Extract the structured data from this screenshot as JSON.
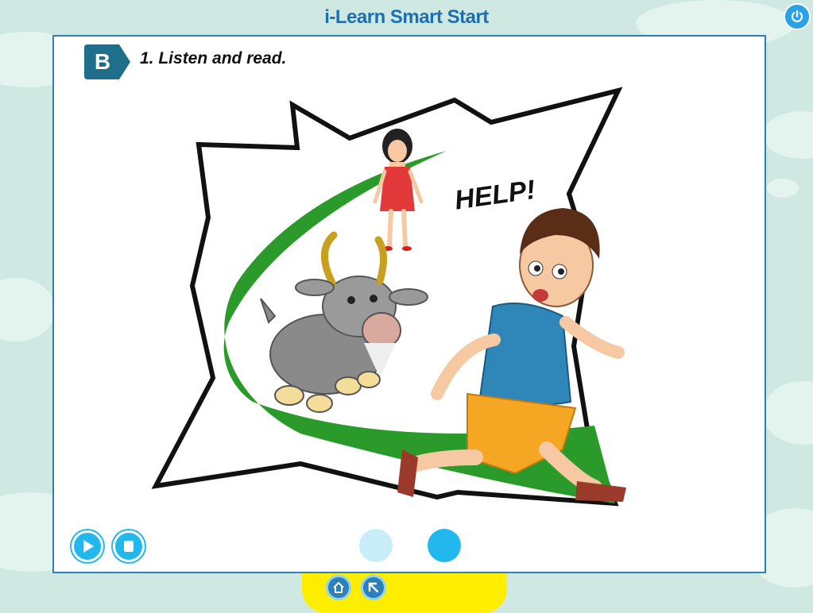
{
  "app": {
    "title": "i-Learn Smart Start"
  },
  "exercise": {
    "section_letter": "B",
    "instruction": "1. Listen and read."
  },
  "scene": {
    "speech_text": "HELP!"
  },
  "colors": {
    "background": "#cfe9e2",
    "title": "#1d6fb0",
    "panel_border": "#2c7fb8",
    "badge": "#1f6f8a",
    "grass": "#2a9a2a",
    "control_blue": "#22b8ee",
    "control_light": "#c9eef9",
    "bottom_bar": "#ffee00"
  },
  "icons": {
    "power": "power-icon",
    "play": "play-icon",
    "stop": "stop-icon",
    "home": "home-icon",
    "back": "back-arrow-icon"
  }
}
